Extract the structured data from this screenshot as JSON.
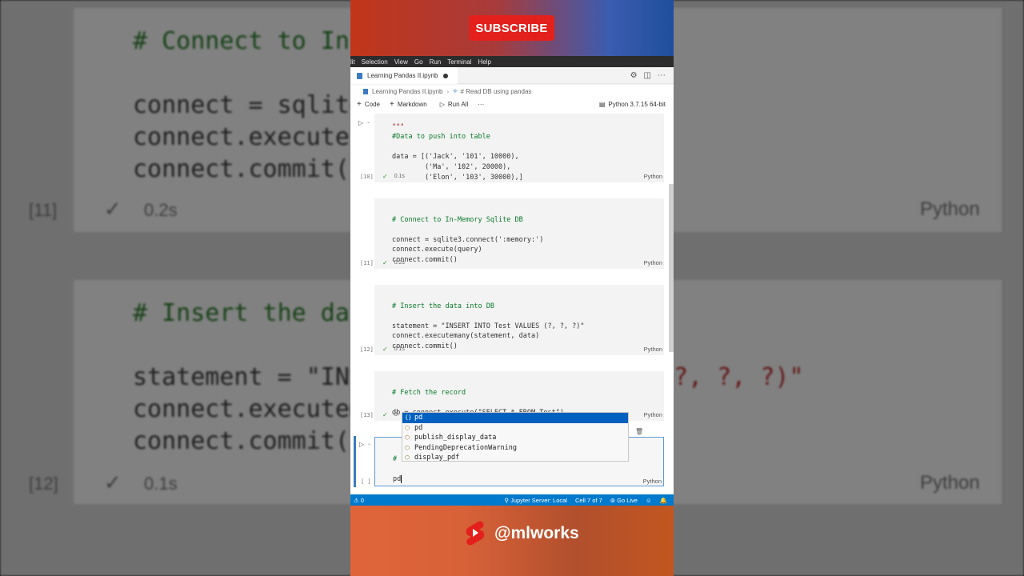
{
  "overlay": {
    "subscribe_label": "SUBSCRIBE",
    "channel_handle": "@mlworks"
  },
  "background_zoom": {
    "line1": "# Connect to In-",
    "line2": "connect = sqlite",
    "line3": "connect.execute(",
    "line4": "connect.commit()",
    "meta1_num": "[11]",
    "meta1_time": "0.2s",
    "meta1_lang": "Python",
    "line5": "# Insert the dat",
    "line6a": "statement = \"INS",
    "line6b": "?, ?, ?)\"",
    "line7": "connect.executem",
    "line8": "connect.commit()",
    "meta2_num": "[12]",
    "meta2_time": "0.1s",
    "meta2_lang": "Python"
  },
  "menubar": [
    "lit",
    "Selection",
    "View",
    "Go",
    "Run",
    "Terminal",
    "Help"
  ],
  "tab": {
    "title": "Learning Pandas II.ipynb"
  },
  "breadcrumb": {
    "file": "Learning Pandas II.ipynb",
    "section": "# Read DB using pandas"
  },
  "toolbar": {
    "code_label": "Code",
    "markdown_label": "Markdown",
    "run_all_label": "Run All",
    "more_label": "···",
    "kernel_label": "Python 3.7.15 64-bit"
  },
  "cells": [
    {
      "number": "[10]",
      "time": "0.1s",
      "lang": "Python",
      "lines": [
        "\"\"\"",
        "#Data to push into table",
        "",
        "data = [('Jack', '101', 10000),",
        "        ('Ma', '102', 20000),",
        "        ('Elon', '103', 30000),]"
      ]
    },
    {
      "number": "[11]",
      "time": "0.2s",
      "lang": "Python",
      "lines": [
        "# Connect to In-Memory Sqlite DB",
        "",
        "connect = sqlite3.connect(':memory:')",
        "connect.execute(query)",
        "connect.commit()"
      ]
    },
    {
      "number": "[12]",
      "time": "0.1s",
      "lang": "Python",
      "lines": [
        "# Insert the data into DB",
        "",
        "statement = \"INSERT INTO Test VALUES (?, ?, ?)\"",
        "connect.executemany(statement, data)",
        "connect.commit()"
      ]
    },
    {
      "number": "[13]",
      "time": "0.",
      "lang": "Python",
      "lines": [
        "# Fetch the record",
        "",
        "db = connect.execute(\"SELECT * FROM Test\")"
      ]
    },
    {
      "number": "[ ]",
      "lang": "Python",
      "lines": [
        "#",
        "",
        "pd"
      ]
    }
  ],
  "autocomplete": [
    {
      "icon": "{}",
      "label": "pd",
      "selected": true
    },
    {
      "icon": "⬡",
      "label": "pd",
      "selected": false
    },
    {
      "icon": "⬡",
      "label": "publish_display_data",
      "selected": false
    },
    {
      "icon": "⬡",
      "label": "PendingDeprecationWarning",
      "selected": false
    },
    {
      "icon": "⬡",
      "label": "display_pdf",
      "selected": false
    }
  ],
  "statusbar": {
    "left": "⚠ 0",
    "jupyter": "Jupyter Server: Local",
    "cell": "Cell 7 of 7",
    "golive": "Go Live"
  }
}
